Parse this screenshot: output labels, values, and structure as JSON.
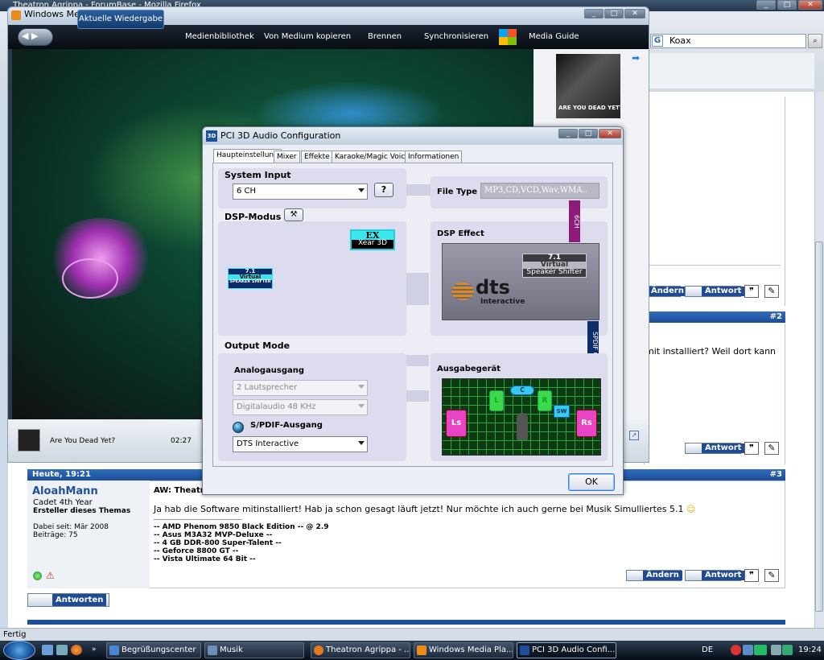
{
  "firefox": {
    "title": "Theatron Agrippa - ForumBase - Mozilla Firefox",
    "search_value": "Koax",
    "status": "Fertig",
    "post_partial_text": "mit installiert? Weil dort kann",
    "post2_number": "#2",
    "post3": {
      "date": "Heute, 19:21",
      "number": "#3",
      "username": "AloahMann",
      "rank": "Cadet 4th Year",
      "role": "Ersteller dieses Themas",
      "joined": "Dabei seit: Mär 2008",
      "posts": "Beiträge: 75",
      "subject": "AW: Theatron",
      "body": "Ja hab die Software mitinstalliert! Hab ja schon gesagt läuft jetzt! Nur möchte ich auch gerne bei Musik Simulliertes 5.1",
      "sig_lines": [
        "-- AMD Phenom 9850 Black Edition -- @ 2.9",
        "-- Asus M3A32 MVP-Deluxe --",
        "-- 4 GB DDR-800 Super-Talent --",
        "-- Geforce 8800 GT --",
        "-- Vista Ultimate 64 Bit --"
      ]
    },
    "buttons": {
      "andern": "Ändern",
      "antwort": "Antwort",
      "antworten": "Antworten"
    }
  },
  "wmp": {
    "title": "Windows Media Player",
    "tabs": [
      "Aktuelle Wiedergabe",
      "Medienbibliothek",
      "Von Medium kopieren",
      "Brennen",
      "Synchronisieren",
      "Media Guide"
    ],
    "album_caption": "ARE YOU DEAD YET?",
    "track_title": "Are You Dead Yet?",
    "track_time": "02:27"
  },
  "dialog": {
    "title": "PCI 3D Audio Configuration",
    "title_icon": "3D",
    "tabs": [
      "Haupteinstellung",
      "Mixer",
      "Effekte",
      "Karaoke/Magic Voice",
      "Informationen"
    ],
    "system_input_label": "System Input",
    "system_input_value": "6 CH",
    "help_label": "?",
    "file_type_label": "File Type",
    "file_type_value": "MP3,CD,VCD,Wav,WMA..",
    "dsp_mode_label": "DSP-Modus",
    "ex_top": "EX",
    "ex_bottom": "Xear 3D",
    "virtual_small_top": "7.1",
    "virtual_small_mid": "Virtual",
    "virtual_small_bot": "SPEAKER SHIFTER",
    "vbar_6ch": "6CH",
    "dsp_effect_label": "DSP Effect",
    "vss_top": "7.1",
    "vss_mid": "Virtual",
    "vss_bot": "Speaker Shifter",
    "dts_text": "dts",
    "dts_sub": "Interactive",
    "vbar_spdif": "SPDIF OUT",
    "output_mode_label": "Output Mode",
    "analog_label": "Analogausgang",
    "speakers_value": "2 Lautsprecher",
    "digital_value": "Digitalaudio  48 KHz",
    "spdif_label": "S/PDIF-Ausgang",
    "spdif_value": "DTS Interactive",
    "output_device_label": "Ausgabegerät",
    "speakers": {
      "left": "L",
      "center": "C",
      "right": "R",
      "ls": "Ls",
      "rs": "Rs",
      "sw": "SW"
    },
    "ok_label": "OK"
  },
  "taskbar": {
    "items": [
      "Begrüßungscenter",
      "Musik",
      "Theatron Agrippa - ...",
      "Windows Media Pla...",
      "PCI 3D Audio Confi..."
    ],
    "lang": "DE",
    "clock": "19:24"
  },
  "colors": {
    "forum_blue": "#1e4f97",
    "dts_orange": "#e08a1e",
    "speaker_green": "#3fd84a",
    "speaker_pink": "#e844c4",
    "bar_purple": "#8e1a7a",
    "bar_navy": "#0e2d6b"
  }
}
